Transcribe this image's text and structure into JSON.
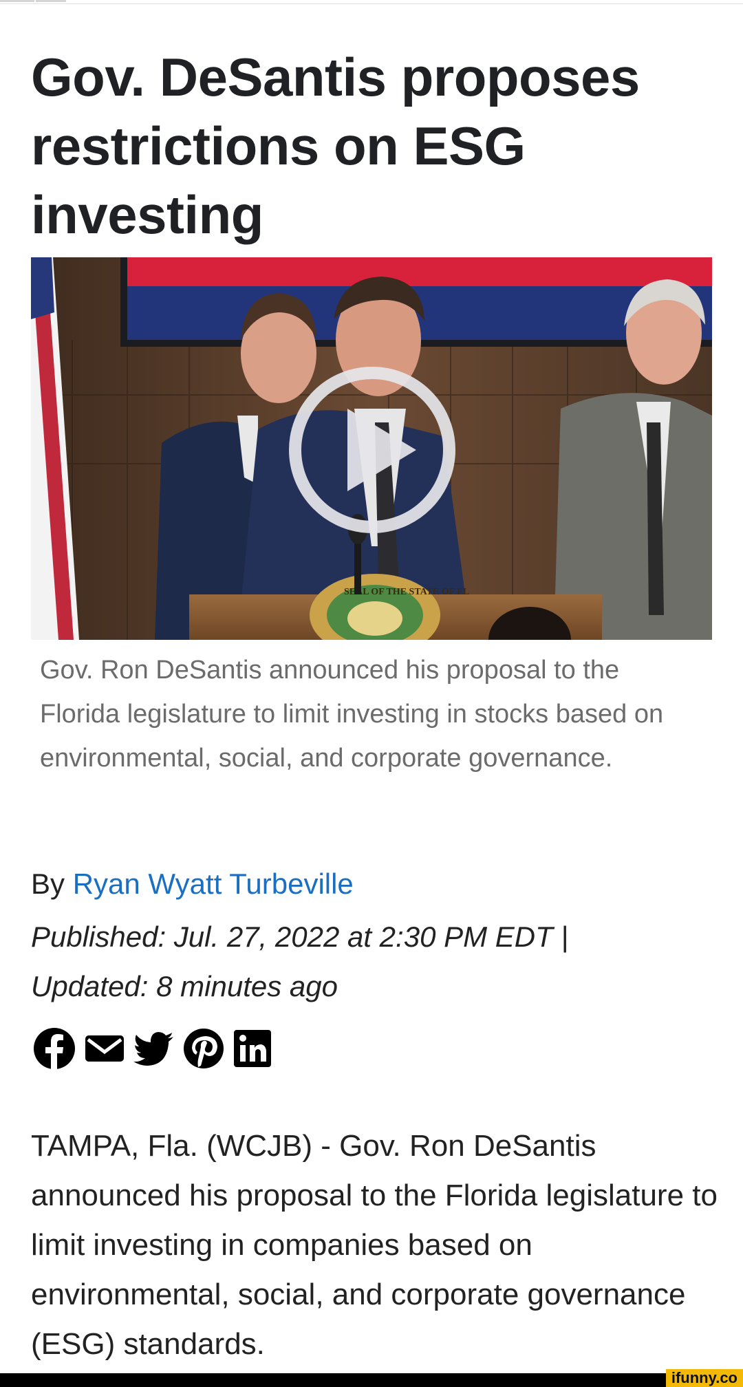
{
  "article": {
    "headline": "Gov. DeSantis proposes restrictions on ESG investing",
    "caption": "Gov. Ron DeSantis announced his proposal to the Florida legislature to limit investing in stocks based on environmental, social, and corporate governance.",
    "byline_prefix": "By ",
    "author": "Ryan Wyatt Turbeville",
    "published": "Published: Jul. 27, 2022 at 2:30 PM EDT",
    "separator": "|",
    "updated": "Updated: 8 minutes ago",
    "body_paragraph": "TAMPA, Fla. (WCJB) - Gov. Ron DeSantis announced his proposal to the Florida legislature to limit investing in companies based on environmental, social, and corporate governance (ESG) standards."
  },
  "video": {
    "seal_text": "SEAL OF THE STATE OF FL"
  },
  "share_icons": [
    "facebook-icon",
    "email-icon",
    "twitter-icon",
    "pinterest-icon",
    "linkedin-icon"
  ],
  "watermark": "ifunny.co",
  "colors": {
    "headline": "#202124",
    "caption": "#6b6b6b",
    "author_link": "#1b6fc2",
    "watermark_bg": "#f4b906"
  }
}
